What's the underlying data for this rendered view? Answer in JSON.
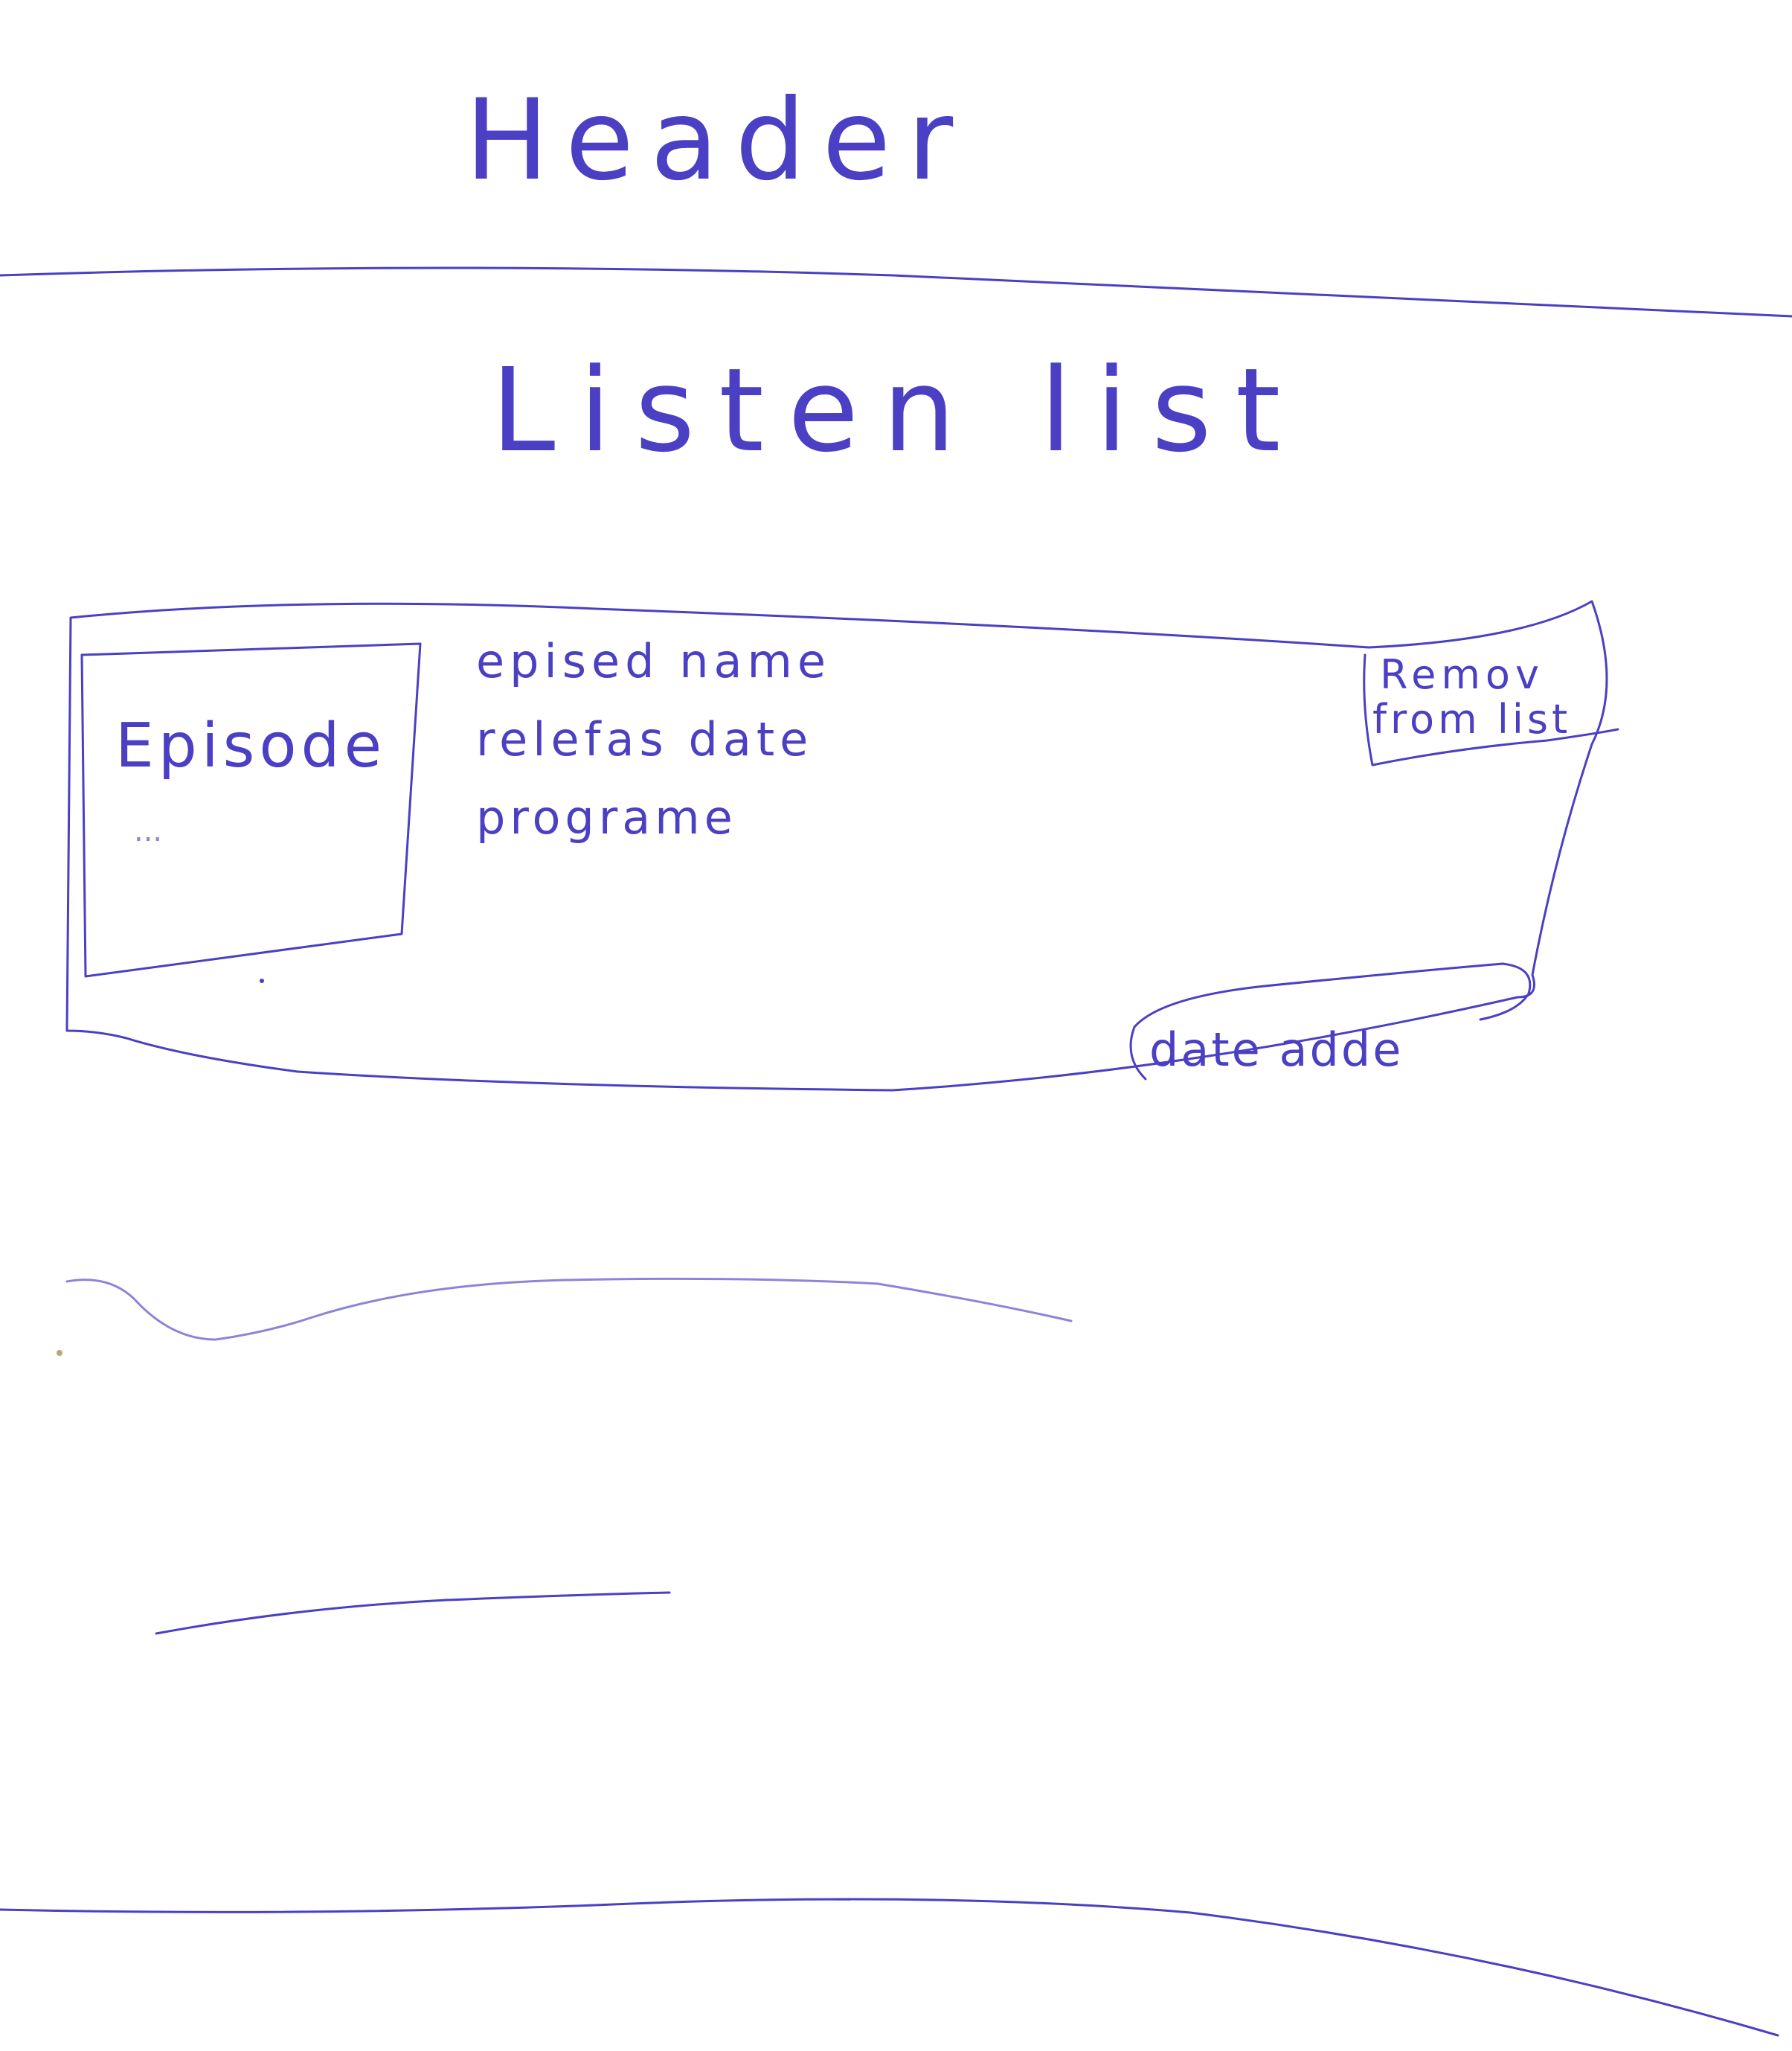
{
  "colors": {
    "ink": "#4b3fc4",
    "ink_light": "#8c84d8",
    "paper": "#ffffff"
  },
  "header": {
    "title": "Header"
  },
  "page": {
    "title": "Listen list"
  },
  "episode_card": {
    "thumbnail_label": "Episode",
    "thumbnail_sublabel": "...",
    "episode_name_label": "epised name",
    "release_date_label": "relefas date",
    "program_label": "programe",
    "remove_button_line1": "Remov",
    "remove_button_line2": "from list",
    "date_added_label": "date adde"
  }
}
